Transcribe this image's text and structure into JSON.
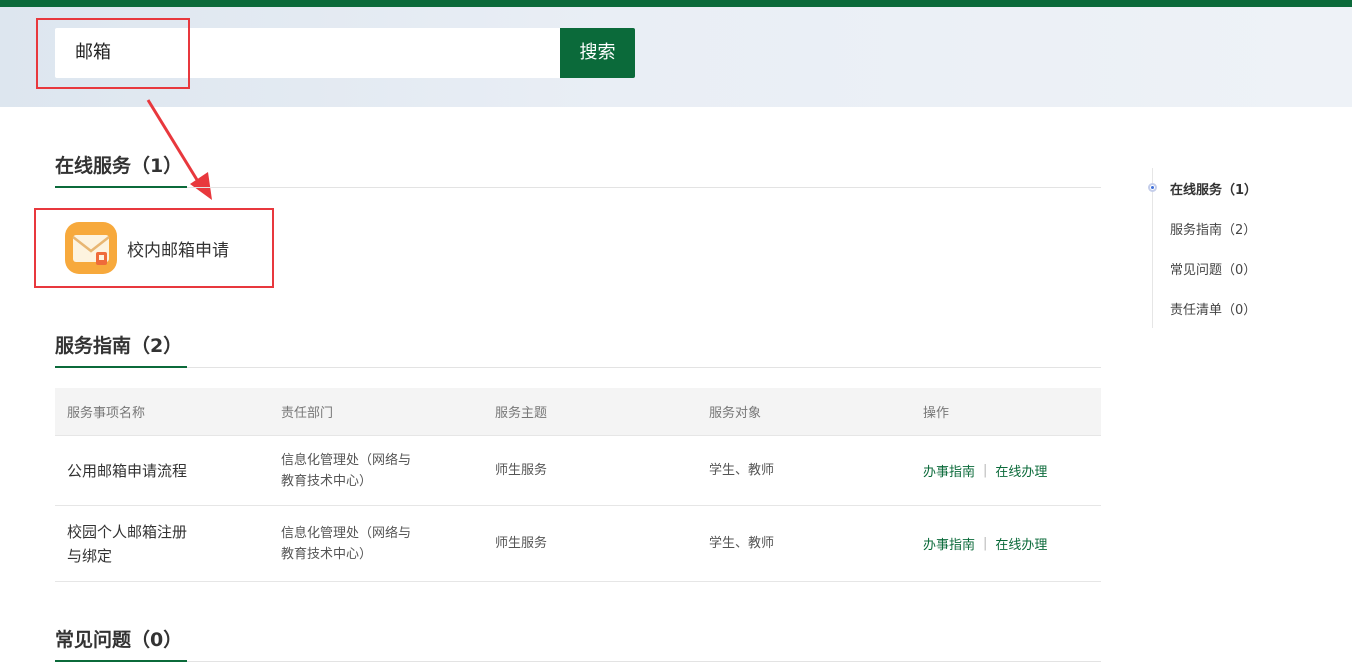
{
  "search": {
    "query": "邮箱",
    "button_label": "搜索"
  },
  "sections": {
    "online": {
      "title": "在线服务（1）",
      "items": [
        {
          "label": "校内邮箱申请",
          "icon": "mail-icon"
        }
      ]
    },
    "guide": {
      "title": "服务指南（2）",
      "headers": [
        "服务事项名称",
        "责任部门",
        "服务主题",
        "服务对象",
        "操作"
      ],
      "rows": [
        {
          "name": "公用邮箱申请流程",
          "dept_line1": "信息化管理处（网络与",
          "dept_line2": "教育技术中心）",
          "topic": "师生服务",
          "target": "学生、教师",
          "op1": "办事指南",
          "op2": "在线办理"
        },
        {
          "name_line1": "校园个人邮箱注册",
          "name_line2": "与绑定",
          "dept_line1": "信息化管理处（网络与",
          "dept_line2": "教育技术中心）",
          "topic": "师生服务",
          "target": "学生、教师",
          "op1": "办事指南",
          "op2": "在线办理"
        }
      ],
      "op_separator": "|"
    },
    "faq": {
      "title": "常见问题（0）"
    }
  },
  "side_nav": {
    "items": [
      "在线服务（1）",
      "服务指南（2）",
      "常见问题（0）",
      "责任清单（0）"
    ],
    "active_index": 0
  },
  "colors": {
    "brand_green": "#0b6a3a",
    "highlight_red": "#e8383d",
    "icon_orange": "#f7a93c"
  }
}
